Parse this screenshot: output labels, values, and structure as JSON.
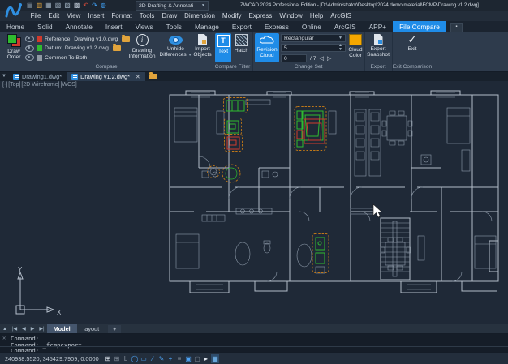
{
  "colors": {
    "accent": "#1f8ce8",
    "ref-red": "#d03a2c",
    "datum-green": "#2fbb2f",
    "common-gray": "#8f99a4",
    "cloud-orange": "#c07818",
    "swatch-orange": "#f5a700"
  },
  "title_bar": {
    "workspace": "2D Drafting & Annotati",
    "title": "ZWCAD 2024 Professional Edition - [D:\\Administrator\\Desktop\\2024 demo material\\FCMP\\Drawing v1.2.dwg]"
  },
  "qat_icons": [
    "new",
    "open",
    "save",
    "save-as",
    "plot",
    "preview",
    "undo",
    "redo",
    "online"
  ],
  "menu": {
    "items": [
      "File",
      "Edit",
      "View",
      "Insert",
      "Format",
      "Tools",
      "Draw",
      "Dimension",
      "Modify",
      "Express",
      "Window",
      "Help",
      "ArcGIS"
    ]
  },
  "ribbon_tabs": {
    "items": [
      "Home",
      "Solid",
      "Annotate",
      "Insert",
      "Views",
      "Tools",
      "Manage",
      "Export",
      "Express",
      "Online",
      "ArcGIS",
      "APP+",
      "File Compare"
    ]
  },
  "compare": {
    "panel_label": "Compare",
    "draw_order": "Draw Order",
    "reference_label": "Reference:",
    "reference_value": "Drawing v1.0.dwg",
    "datum_label": "Datum:",
    "datum_value": "Drawing v1.2.dwg",
    "common_label": "Common To Both",
    "drawing_information": "Drawing Information",
    "unhide_differences": "Unhide Differences",
    "import_objects": "Import Objects"
  },
  "compare_filter": {
    "panel_label": "Compare Filter",
    "text": "Text",
    "hatch": "Hatch"
  },
  "change_set": {
    "panel_label": "Change Set",
    "revision_cloud": "Revision Cloud",
    "shape": "Rectangular",
    "size": "5",
    "index": "0",
    "total": "/ 7",
    "cloud_color": "Cloud Color"
  },
  "export": {
    "panel_label": "Export",
    "snapshot": "Export Snapshot"
  },
  "exit": {
    "panel_label": "Exit Comparison",
    "exit": "Exit"
  },
  "doc_tabs": {
    "tab1": "Drawing1.dwg*",
    "tab2": "Drawing v1.2.dwg*",
    "close": "✕"
  },
  "viewport": {
    "minimize": "[-]",
    "view": "[Top]",
    "visual_style": "[2D Wireframe]",
    "ucs": "[WCS]",
    "axis_x": "X",
    "axis_y": "Y"
  },
  "layout_bar": {
    "model": "Model",
    "layout": "layout",
    "add": "+"
  },
  "command": {
    "history1": "Command:",
    "history2": "Command: _fcmpexport",
    "prompt": "Command:"
  },
  "status_bar": {
    "coordinates": "240938.5520, 345429.7909, 0.0000",
    "icons": [
      "grid",
      "snap",
      "ortho",
      "polar",
      "esnap",
      "etrack",
      "dyn-input",
      "lineweight",
      "transparency",
      "selection-cycling",
      "quick-properties",
      "select",
      "display"
    ]
  }
}
